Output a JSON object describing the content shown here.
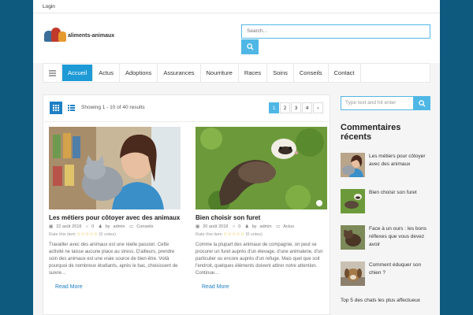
{
  "topbar": {
    "login": "Login"
  },
  "header": {
    "logo_text": "aliments-animaux",
    "search_placeholder": "Search..."
  },
  "nav": {
    "items": [
      "Accueil",
      "Actus",
      "Adoptions",
      "Assurances",
      "Nourriture",
      "Races",
      "Soins",
      "Conseils",
      "Contact"
    ],
    "active": "Accueil"
  },
  "toolbar": {
    "results_text": "Showing 1 - 10 of 40 results",
    "pages": [
      "1",
      "2",
      "3",
      "4"
    ],
    "current_page": "1",
    "next": "›"
  },
  "posts": [
    {
      "title": "Les métiers pour côtoyer avec des animaux",
      "date": "22 août 2018",
      "comments": "0",
      "author_prefix": "by",
      "author": "admin",
      "category": "Conseils",
      "rate_label": "Rate this item",
      "rating_stars": 0,
      "votes": "(0 votes)",
      "excerpt": "Travailler avec des animaux est une réelle passion. Cette activité ne laisse aucune place au stress. D'ailleurs, prendre soin des animaux est une vraie source de bien-être. Voilà pourquoi de nombreux étudiants, après le bac, choisissent de suivre…",
      "read_more": "Read More"
    },
    {
      "title": "Bien choisir son furet",
      "date": "20 août 2018",
      "comments": "0",
      "author_prefix": "by",
      "author": "admin",
      "category": "Actus",
      "rate_label": "Rate this item",
      "rating_stars": 0,
      "votes": "(0 votes)",
      "excerpt": "Comme la plupart des animaux de compagnie, on peut se procurer un furet auprès d'un élevage, d'une animalerie, d'un particulier ou encore auprès d'un refuge. Mais quel que soit l'endroit, quelques éléments doivent attirer notre attention. Continue…",
      "read_more": "Read More"
    }
  ],
  "sidebar": {
    "search_placeholder": "Type text and hit enter",
    "title": "Commentaires récents",
    "items": [
      "Les métiers pour côtoyer avec des animaux",
      "Bien choisir son furet",
      "Face à un ours : les bons réflexes que vous devez avoir",
      "Comment éduquer son chien ?"
    ],
    "last_item": "Top 5 des chats les plus affectueux"
  },
  "colors": {
    "accent": "#1e9bd7",
    "search_border": "#4fb7e5",
    "frame": "#0e5a7f",
    "stars": "#e6b31e"
  }
}
